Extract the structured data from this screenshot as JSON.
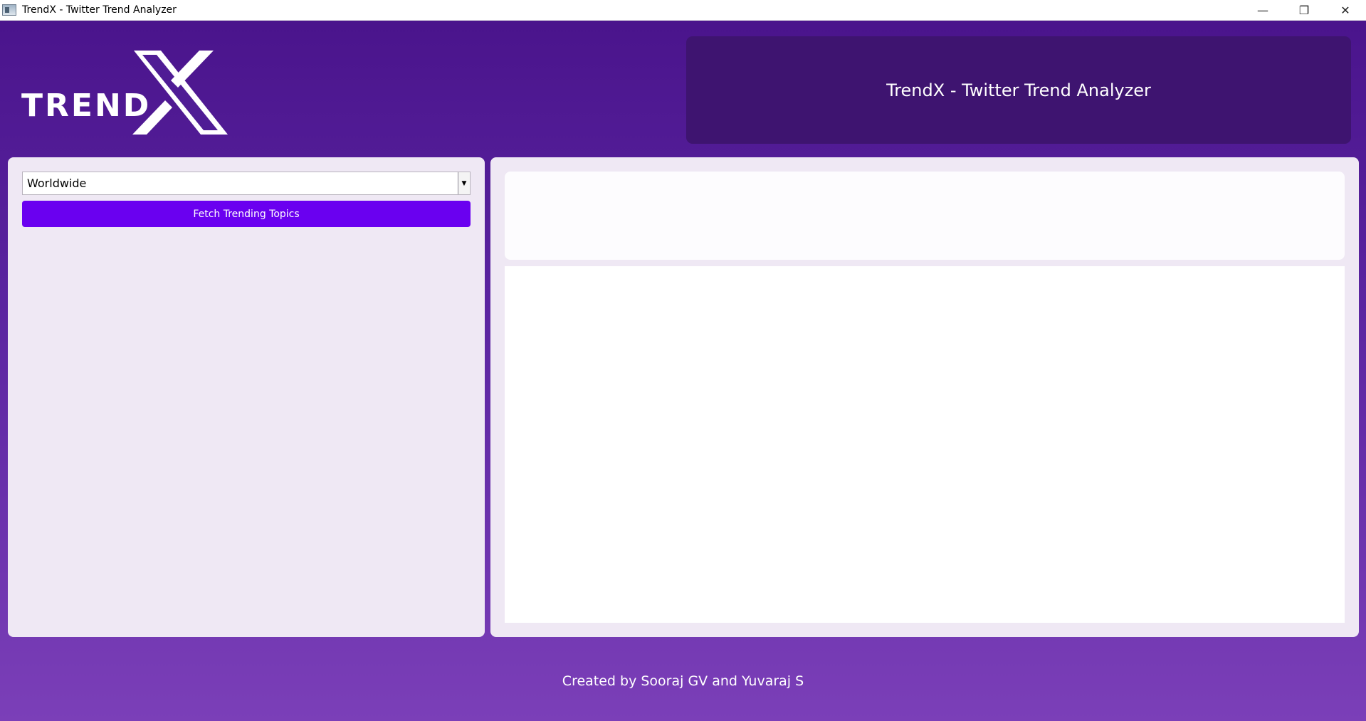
{
  "window": {
    "title": "TrendX - Twitter Trend Analyzer",
    "controls": {
      "minimize": "—",
      "maximize": "❐",
      "close": "✕"
    }
  },
  "logo": {
    "text": "TREND",
    "mark": "X"
  },
  "header": {
    "title": "TrendX - Twitter Trend Analyzer"
  },
  "controls": {
    "location_select": {
      "selected": "Worldwide",
      "arrow": "▼"
    },
    "fetch_button": "Fetch Trending Topics"
  },
  "footer": {
    "credit": "Created by Sooraj GV and Yuvaraj S"
  },
  "colors": {
    "background_top": "#4a148c",
    "background_bottom": "#7b3fb8",
    "header_box": "#3e1470",
    "panel": "#efe8f4",
    "button": "#6a00f0"
  }
}
